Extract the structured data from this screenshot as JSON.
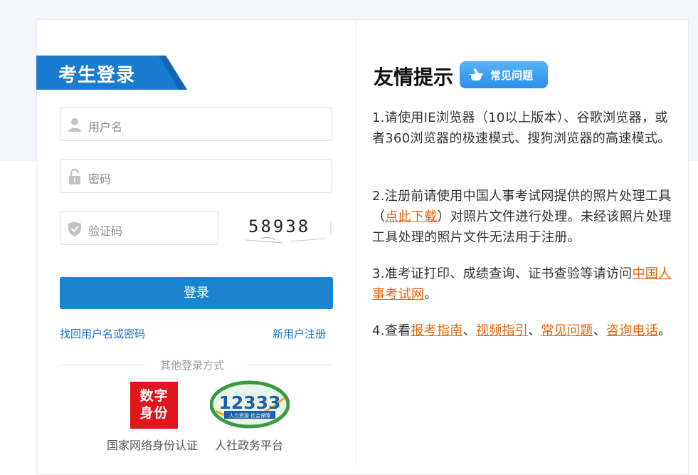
{
  "login": {
    "title": "考生登录",
    "username_placeholder": "用户名",
    "password_placeholder": "密码",
    "captcha_placeholder": "验证码",
    "captcha_text": "58938",
    "submit_label": "登录",
    "recover_link": "找回用户名或密码",
    "register_link": "新用户注册",
    "other_methods": "其他登录方式",
    "providers": [
      {
        "name": "国家网络身份认证",
        "logo_text": "数字身份"
      },
      {
        "name": "人社政务平台",
        "logo_text": "12333",
        "logo_subtext": "人力资源 社会保障"
      }
    ]
  },
  "tips": {
    "title": "友情提示",
    "faq_badge": "常见问题",
    "items": [
      {
        "text": "1.请使用IE浏览器（10以上版本）、谷歌浏览器，或者360浏览器的极速模式、搜狗浏览器的高速模式。"
      },
      {
        "pre": "2.注册前请使用中国人事考试网提供的照片处理工具（",
        "link": "点此下载",
        "post": "）对照片文件进行处理。未经该照片处理工具处理的照片文件无法用于注册。"
      },
      {
        "pre": "3.准考证打印、成绩查询、证书查验等请访问",
        "link": "中国人事考试网",
        "post": "。"
      },
      {
        "pre": "4.查看",
        "links": [
          "报考指南",
          "视频指引",
          "常见问题",
          "咨询电话"
        ],
        "sep": "、",
        "post": "。"
      }
    ]
  },
  "colors": {
    "primary": "#1a84ce",
    "link": "#1a74c8",
    "orange_link": "#e8630a",
    "id_logo_red": "#e1161c"
  }
}
